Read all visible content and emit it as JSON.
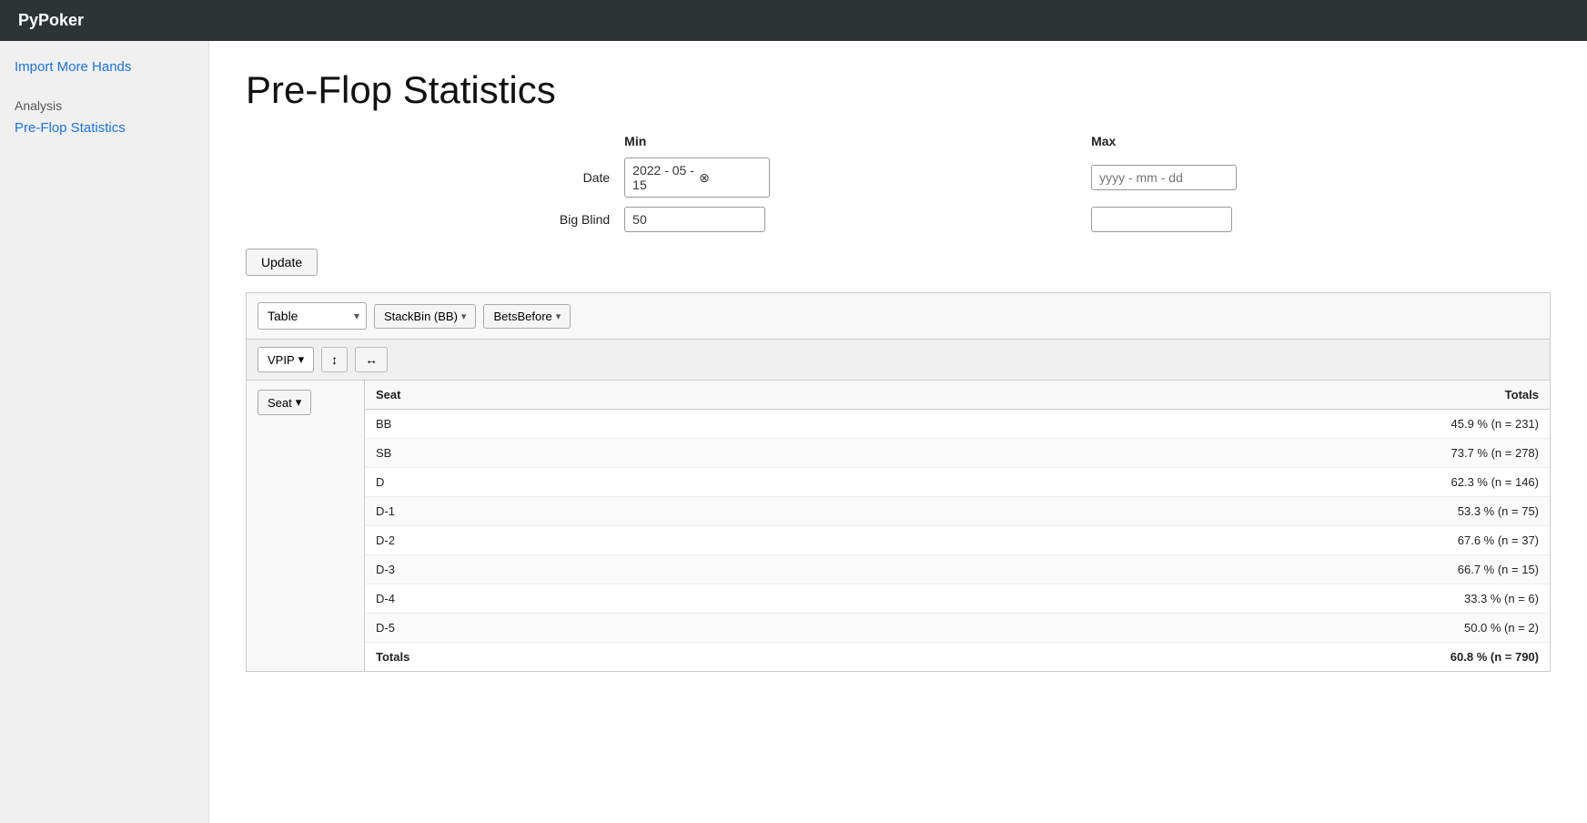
{
  "app": {
    "title": "PyPoker"
  },
  "sidebar": {
    "import_label": "Import More Hands",
    "analysis_label": "Analysis",
    "preflop_label": "Pre-Flop Statistics"
  },
  "main": {
    "page_title": "Pre-Flop Statistics",
    "filters": {
      "min_label": "Min",
      "max_label": "Max",
      "date_label": "Date",
      "date_min_value": "2022 - 05 - 15",
      "date_max_placeholder": "yyyy - mm - dd",
      "big_blind_label": "Big Blind",
      "big_blind_min_value": "50",
      "big_blind_max_value": "",
      "update_btn": "Update"
    },
    "dropdowns": {
      "table_label": "Table",
      "stackbin_label": "StackBin (BB)",
      "betsbefore_label": "BetsBefore"
    },
    "metric": {
      "vpip_label": "VPIP"
    },
    "seat_btn": "Seat",
    "table_headers": {
      "seat": "Seat",
      "totals": "Totals"
    },
    "rows": [
      {
        "seat": "BB",
        "totals": "45.9 % (n = 231)"
      },
      {
        "seat": "SB",
        "totals": "73.7 % (n = 278)"
      },
      {
        "seat": "D",
        "totals": "62.3 % (n = 146)"
      },
      {
        "seat": "D-1",
        "totals": "53.3 % (n = 75)"
      },
      {
        "seat": "D-2",
        "totals": "67.6 % (n = 37)"
      },
      {
        "seat": "D-3",
        "totals": "66.7 % (n = 15)"
      },
      {
        "seat": "D-4",
        "totals": "33.3 % (n = 6)"
      },
      {
        "seat": "D-5",
        "totals": "50.0 % (n = 2)"
      },
      {
        "seat": "Totals",
        "totals": "60.8 % (n = 790)"
      }
    ]
  }
}
